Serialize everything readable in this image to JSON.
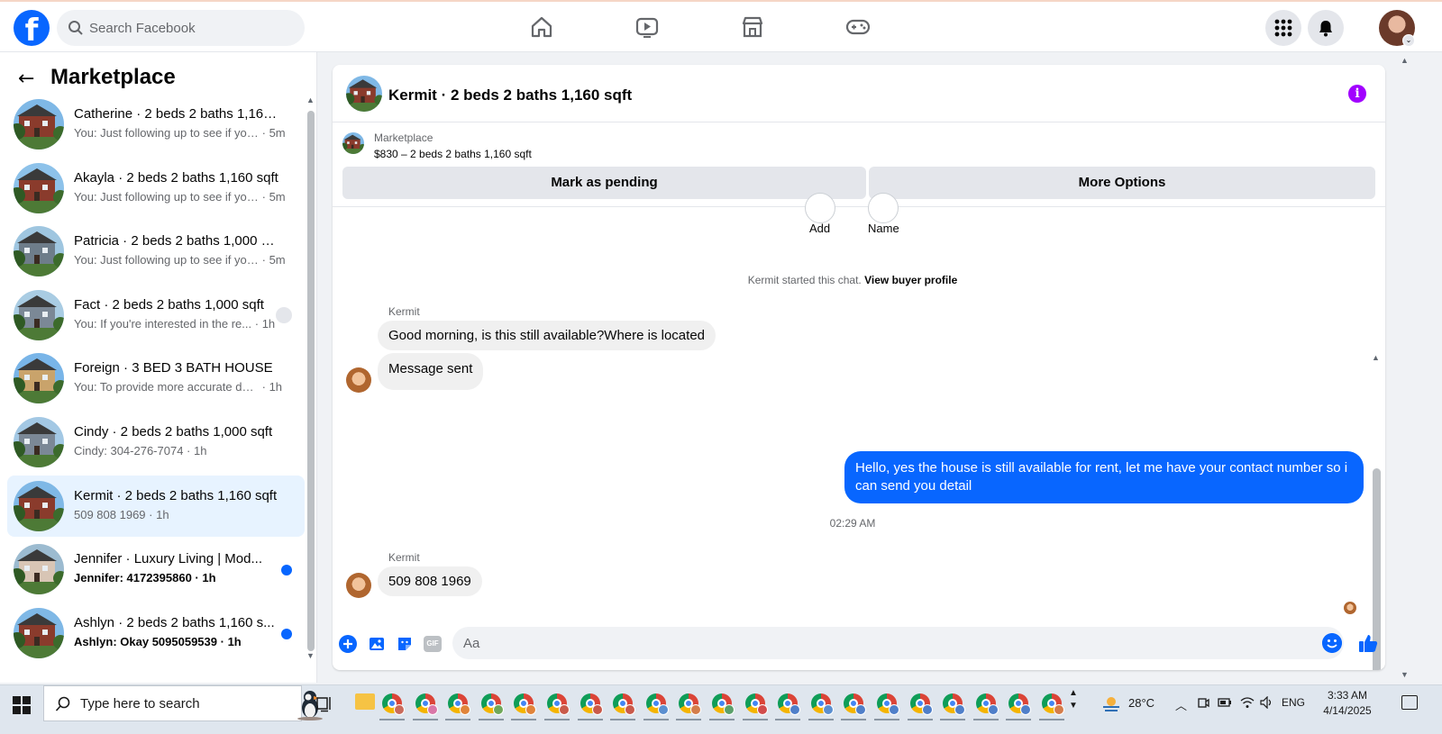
{
  "topbar": {
    "logo": "f",
    "search_placeholder": "Search Facebook",
    "nav_icons": [
      "home-icon",
      "video-icon",
      "marketplace-icon",
      "gaming-icon"
    ],
    "right_icons": [
      "menu-grid-icon",
      "notifications-icon",
      "profile-avatar"
    ],
    "chevron": "⌄"
  },
  "sidebar": {
    "back": "←",
    "title": "Marketplace",
    "conversations": [
      {
        "title": "Catherine · 2 beds 2 baths 1,160 ...",
        "snippet": "You: Just following up to see if you...",
        "time": "5m",
        "unread": false
      },
      {
        "title": "Akayla · 2 beds 2 baths 1,160 sqft",
        "snippet": "You: Just following up to see if you...",
        "time": "5m",
        "unread": false
      },
      {
        "title": "Patricia · 2 beds 2 baths 1,000 sqft",
        "snippet": "You: Just following up to see if you...",
        "time": "5m",
        "unread": false
      },
      {
        "title": "Fact · 2 beds 2 baths 1,000 sqft",
        "snippet": "You: If you're interested in the re...",
        "time": "1h",
        "unread": false
      },
      {
        "title": "Foreign · 3 BED 3 BATH HOUSE",
        "snippet": "You: To provide more accurate deta...",
        "time": "1h",
        "unread": false
      },
      {
        "title": "Cindy · 2 beds 2 baths 1,000 sqft",
        "snippet": "Cindy: 304-276-7074",
        "time": "1h",
        "unread": false
      },
      {
        "title": "Kermit · 2 beds 2 baths 1,160 sqft",
        "snippet": "509 808 1969",
        "time": "1h",
        "unread": false,
        "active": true
      },
      {
        "title": "Jennifer · Luxury Living | Mod...",
        "snippet": "Jennifer: 4172395860",
        "time": "1h",
        "unread": true
      },
      {
        "title": "Ashlyn · 2 beds 2 baths 1,160 s...",
        "snippet": "Ashlyn: Okay 5095059539",
        "time": "1h",
        "unread": true
      }
    ]
  },
  "chat": {
    "header_title": "Kermit · 2 beds 2 baths 1,160 sqft",
    "info_icon": "i",
    "listing": {
      "label": "Marketplace",
      "price_title": "$830 – 2 beds 2 baths 1,160 sqft",
      "mark_pending": "Mark as pending",
      "more_options": "More Options"
    },
    "actions": {
      "add": "Add",
      "name": "Name"
    },
    "started_prefix": "Kermit started this chat.",
    "view_profile": "View buyer profile",
    "messages": [
      {
        "sender": "Kermit",
        "text": "Good morning, is this still available?Where is located"
      },
      {
        "text": "Message sent"
      },
      {
        "text": "Hello, yes the house is still available for rent, let me have your contact number so i can send you detail",
        "outgoing": true
      },
      {
        "timestamp": "02:29 AM"
      },
      {
        "sender": "Kermit",
        "text": "509 808 1969"
      }
    ],
    "composer_placeholder": "Aa",
    "composer_icons": [
      "plus-icon",
      "photo-icon",
      "sticker-icon",
      "gif-icon",
      "emoji-icon",
      "like-icon"
    ],
    "gif": "GIF"
  },
  "taskbar": {
    "search_text": "Type here to search",
    "weather": "28°C",
    "language": "ENG",
    "time": "3:33 AM",
    "date": "4/14/2025"
  },
  "colors": {
    "brand_blue": "#0866ff",
    "active_row": "#e7f3ff",
    "info_purple": "#a100ff"
  }
}
